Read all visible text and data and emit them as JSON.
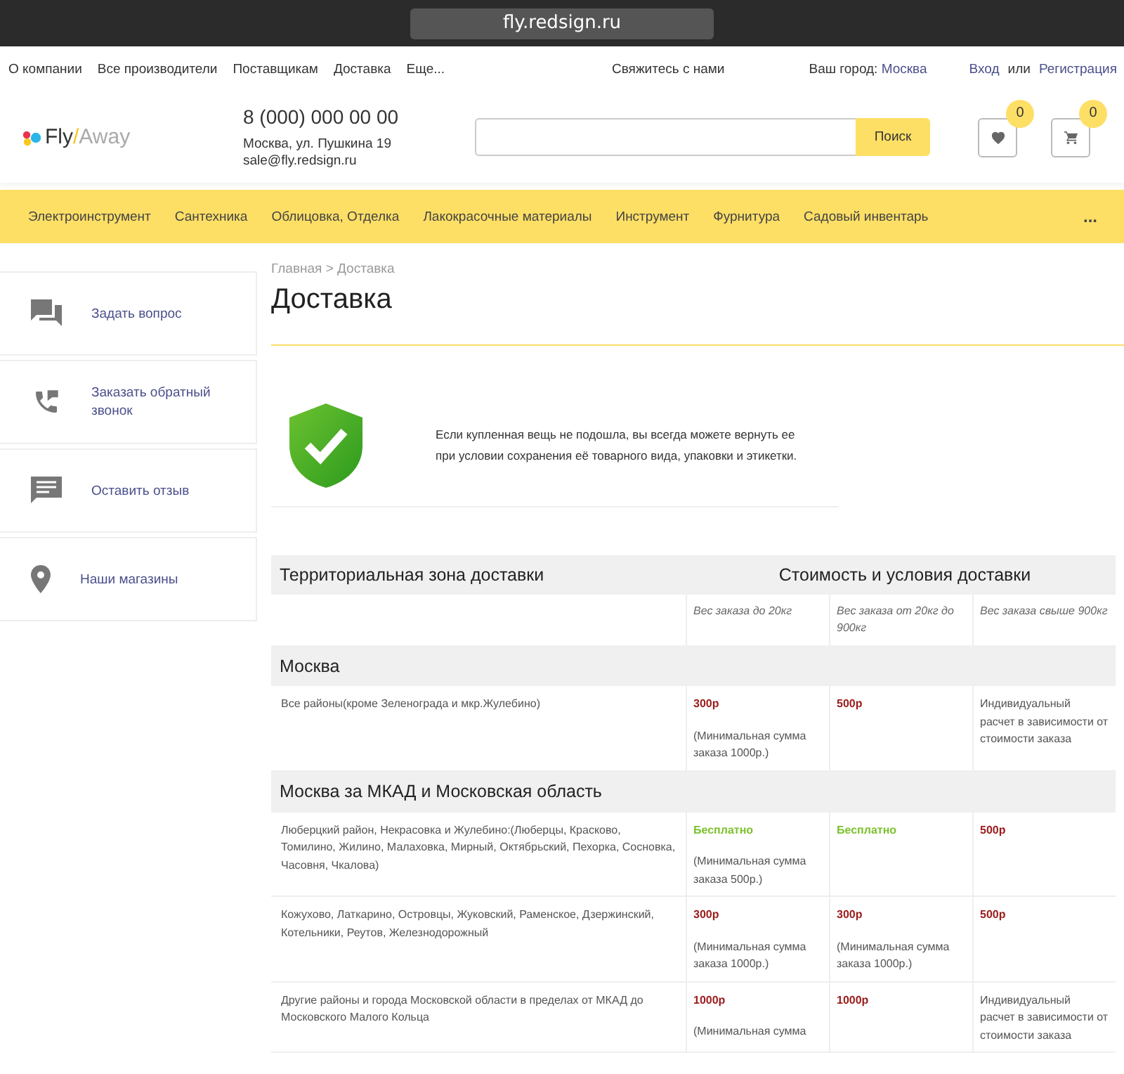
{
  "browser": {
    "url": "fly.redsign.ru"
  },
  "top_nav": {
    "links": [
      "О компании",
      "Все производители",
      "Поставщикам",
      "Доставка",
      "Еще..."
    ],
    "contact": "Свяжитесь с нами",
    "city_label": "Ваш город:",
    "city": "Москва",
    "login": "Вход",
    "or": "или",
    "register": "Регистрация"
  },
  "header": {
    "logo_main": "Fly",
    "logo_slash": "/",
    "logo_rest": "Away",
    "phone": "8 (000) 000 00 00",
    "address": "Москва, ул. Пушкина 19",
    "email": "sale@fly.redsign.ru",
    "search_button": "Поиск",
    "favorites_count": "0",
    "cart_count": "0"
  },
  "catalog_menu": {
    "items": [
      "Электроинструмент",
      "Сантехника",
      "Облицовка, Отделка",
      "Лакокрасочные материалы",
      "Инструмент",
      "Фурнитура",
      "Садовый инвентарь"
    ],
    "more": "..."
  },
  "sidebar": {
    "items": [
      {
        "kind": "question",
        "label": "Задать вопрос"
      },
      {
        "kind": "callback",
        "label": "Заказать обратный звонок"
      },
      {
        "kind": "review",
        "label": "Оставить отзыв"
      },
      {
        "kind": "stores",
        "label": "Наши магазины"
      }
    ]
  },
  "breadcrumb": {
    "home": "Главная",
    "separator": ">",
    "current": "Доставка"
  },
  "page_title": "Доставка",
  "guarantee_text": "Если купленная вещь не подошла, вы всегда можете вернуть ее при условии сохранения её товарного вида, упаковки и этикетки.",
  "table": {
    "columns": [
      "Территориальная зона доставки",
      "Стоимость и условия доставки"
    ],
    "weight_columns": [
      "Вес заказа до 20кг",
      "Вес заказа от 20кг до 900кг",
      "Вес заказа свыше 900кг"
    ],
    "sections": [
      {
        "title": "Москва",
        "rows": [
          {
            "zone": "Все районы(кроме Зеленограда и мкр.Жулебино)",
            "cells": [
              {
                "kind": "paid",
                "price": "300р",
                "note": "(Минимальная сумма заказа 1000р.)"
              },
              {
                "kind": "paid",
                "price": "500р"
              },
              {
                "kind": "text",
                "note": "Индивидуальный расчет в зависимости от стоимости заказа"
              }
            ]
          }
        ]
      },
      {
        "title": "Москва за МКАД и Московская область",
        "rows": [
          {
            "zone": "Люберцкий район, Некрасовка и Жулебино:(Люберцы, Красково, Томилино, Жилино, Малаховка, Мирный, Октябрьский, Пехорка, Сосновка, Часовня, Чкалова)",
            "cells": [
              {
                "kind": "free",
                "price": "Бесплатно",
                "note": "(Минимальная сумма заказа 500р.)"
              },
              {
                "kind": "free",
                "price": "Бесплатно"
              },
              {
                "kind": "paid",
                "price": "500р"
              }
            ]
          },
          {
            "zone": "Кожухово, Латкарино, Островцы, Жуковский, Раменское, Дзержинский, Котельники, Реутов, Железнодорожный",
            "cells": [
              {
                "kind": "paid",
                "price": "300р",
                "note": "(Минимальная сумма заказа 1000р.)"
              },
              {
                "kind": "paid",
                "price": "300р",
                "note": "(Минимальная сумма заказа 1000р.)"
              },
              {
                "kind": "paid",
                "price": "500р"
              }
            ]
          },
          {
            "zone": "Другие районы и города Московской области в пределах от МКАД до Московского Малого Кольца",
            "cells": [
              {
                "kind": "paid",
                "price": "1000р",
                "note": "(Минимальная сумма"
              },
              {
                "kind": "paid",
                "price": "1000р"
              },
              {
                "kind": "text",
                "note": "Индивидуальный расчет в зависимости от стоимости заказа"
              }
            ]
          }
        ]
      }
    ]
  }
}
